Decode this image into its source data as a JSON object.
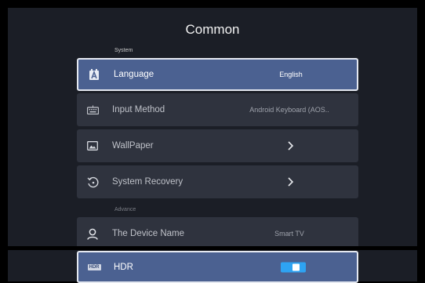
{
  "header": {
    "title": "Common"
  },
  "sections": {
    "system": "System",
    "advance": "Advance"
  },
  "rows": [
    {
      "label": "Language",
      "value": "English",
      "icon": "language-icon"
    },
    {
      "label": "Input Method",
      "value": "Android Keyboard (AOS..",
      "icon": "keyboard-icon"
    },
    {
      "label": "WallPaper",
      "icon": "wallpaper-icon"
    },
    {
      "label": "System Recovery",
      "icon": "recovery-icon"
    },
    {
      "label": "The Device Name",
      "value": "Smart TV",
      "icon": "person-icon"
    },
    {
      "label": "HDR",
      "icon": "hdr-icon",
      "toggle_on": true,
      "badge": "HDR"
    }
  ],
  "colors": {
    "selected_row": "#4b6191",
    "row": "#2f333e",
    "toggle": "#2ea3f2",
    "background": "#1b1e26"
  }
}
